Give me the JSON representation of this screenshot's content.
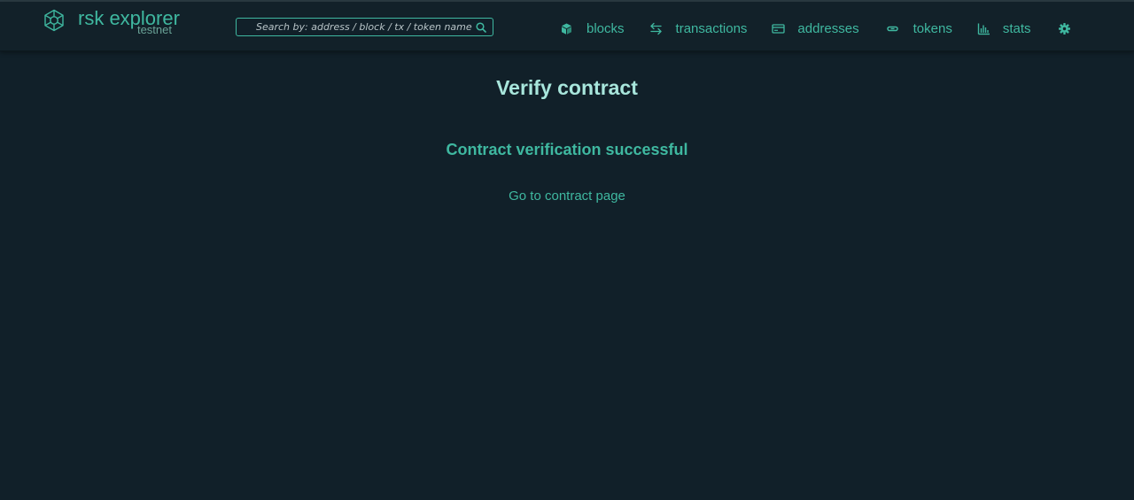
{
  "brand": {
    "name": "rsk explorer",
    "network": "testnet"
  },
  "search": {
    "placeholder": "Search by: address / block / tx / token name",
    "value": "",
    "icon": "search-icon"
  },
  "nav": {
    "items": [
      {
        "label": "blocks",
        "icon": "cube-icon"
      },
      {
        "label": "transactions",
        "icon": "arrows-exchange-icon"
      },
      {
        "label": "addresses",
        "icon": "wallet-card-icon"
      },
      {
        "label": "tokens",
        "icon": "token-pill-icon"
      },
      {
        "label": "stats",
        "icon": "bar-chart-icon"
      }
    ],
    "settings_icon": "gear-icon"
  },
  "main": {
    "title": "Verify contract",
    "status": "Contract verification successful",
    "link_label": "Go to contract page"
  },
  "colors": {
    "background": "#112029",
    "accent": "#3fb8a0",
    "title": "#a8e6dc"
  }
}
